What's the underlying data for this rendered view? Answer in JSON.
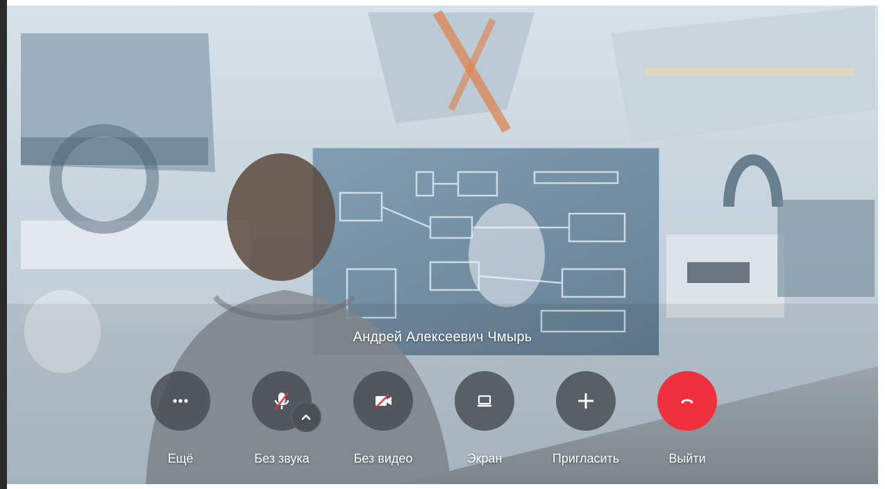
{
  "participant": {
    "name": "Андрей Алексеевич Чмырь"
  },
  "controls": [
    {
      "key": "more",
      "label": "Ещё",
      "icon": "more-dots-icon"
    },
    {
      "key": "mute",
      "label": "Без звука",
      "icon": "mic-off-icon"
    },
    {
      "key": "video",
      "label": "Без видео",
      "icon": "camera-off-icon"
    },
    {
      "key": "screen",
      "label": "Экран",
      "icon": "screen-share-icon"
    },
    {
      "key": "invite",
      "label": "Пригласить",
      "icon": "plus-icon"
    },
    {
      "key": "leave",
      "label": "Выйти",
      "icon": "hangup-icon"
    }
  ],
  "colors": {
    "control_bg": "#464c52",
    "hangup_bg": "#f0303c",
    "label_text": "#ffffff"
  }
}
